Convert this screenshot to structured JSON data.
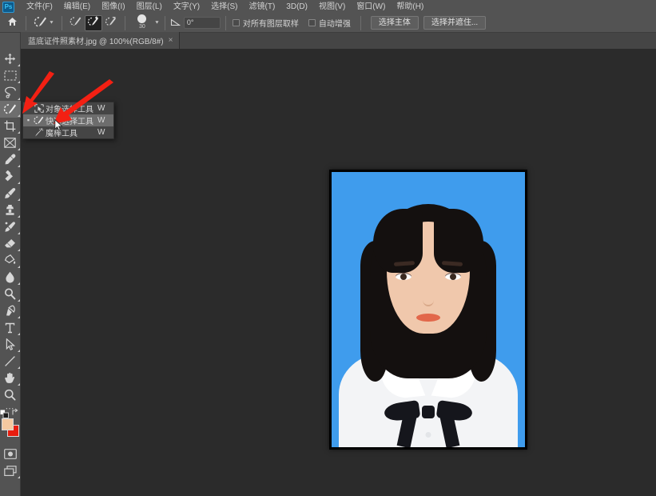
{
  "app": {
    "logo_text": "Ps"
  },
  "menubar": {
    "items": [
      {
        "label": "文件(F)"
      },
      {
        "label": "编辑(E)"
      },
      {
        "label": "图像(I)"
      },
      {
        "label": "图层(L)"
      },
      {
        "label": "文字(Y)"
      },
      {
        "label": "选择(S)"
      },
      {
        "label": "滤镜(T)"
      },
      {
        "label": "3D(D)"
      },
      {
        "label": "视图(V)"
      },
      {
        "label": "窗口(W)"
      },
      {
        "label": "帮助(H)"
      }
    ]
  },
  "optionsbar": {
    "home_icon": "home-icon",
    "tool_preview_icon": "quick-selection-tool-icon",
    "mode_new_icon": "selection-new-icon",
    "mode_add_icon": "selection-add-icon",
    "mode_subtract_icon": "selection-subtract-icon",
    "brush_size": "30",
    "angle_value": "0°",
    "sample_all_layers_label": "对所有图层取样",
    "auto_enhance_label": "自动增强",
    "select_subject_label": "选择主体",
    "select_and_mask_label": "选择并遮住..."
  },
  "tabs": [
    {
      "title": "蓝底证件照素材.jpg @ 100%(RGB/8#)",
      "close": "×"
    }
  ],
  "toolbar": {
    "tools": [
      {
        "name": "move-tool",
        "icon": "move-icon"
      },
      {
        "name": "rectangular-marquee-tool",
        "icon": "marquee-icon"
      },
      {
        "name": "lasso-tool",
        "icon": "lasso-icon"
      },
      {
        "name": "quick-selection-tool",
        "icon": "quick-selection-icon",
        "selected": true
      },
      {
        "name": "crop-tool",
        "icon": "crop-icon"
      },
      {
        "name": "frame-tool",
        "icon": "frame-icon"
      },
      {
        "name": "eyedropper-tool",
        "icon": "eyedropper-icon"
      },
      {
        "name": "spot-healing-brush-tool",
        "icon": "healing-brush-icon"
      },
      {
        "name": "brush-tool",
        "icon": "brush-icon"
      },
      {
        "name": "clone-stamp-tool",
        "icon": "clone-stamp-icon"
      },
      {
        "name": "history-brush-tool",
        "icon": "history-brush-icon"
      },
      {
        "name": "eraser-tool",
        "icon": "eraser-icon"
      },
      {
        "name": "gradient-tool",
        "icon": "paint-bucket-icon"
      },
      {
        "name": "blur-tool",
        "icon": "blur-drop-icon"
      },
      {
        "name": "dodge-tool",
        "icon": "dodge-icon"
      },
      {
        "name": "pen-tool",
        "icon": "pen-icon"
      },
      {
        "name": "type-tool",
        "icon": "type-icon"
      },
      {
        "name": "path-selection-tool",
        "icon": "path-arrow-icon"
      },
      {
        "name": "line-tool",
        "icon": "line-icon"
      },
      {
        "name": "hand-tool",
        "icon": "hand-icon"
      },
      {
        "name": "zoom-tool",
        "icon": "zoom-icon"
      }
    ],
    "more_tools_icon": "ellipsis-icon",
    "swap_colors_icon": "swap-colors-icon",
    "default_colors_icon": "default-colors-icon",
    "foreground_color": "#f5c9a0",
    "background_color": "#e71d0f",
    "quick_mask_icon": "quick-mask-icon",
    "screen_mode_icon": "screen-mode-icon"
  },
  "flyout": {
    "items": [
      {
        "label": "对象选择工具",
        "shortcut": "W",
        "icon": "object-selection-icon",
        "bullet": "",
        "highlighted": false
      },
      {
        "label": "快速选择工具",
        "shortcut": "W",
        "icon": "quick-selection-icon",
        "bullet": "▪",
        "highlighted": true
      },
      {
        "label": "魔棒工具",
        "shortcut": "W",
        "icon": "magic-wand-icon",
        "bullet": "",
        "highlighted": false
      }
    ]
  },
  "canvas": {
    "background_color": "#2b2b2b",
    "photo": {
      "name": "id-photo-blue-background",
      "background_color": "#3f9ced",
      "shirt_color": "#ffffff",
      "hair_color": "#14100f",
      "bowtie_color": "#15161c"
    }
  },
  "annotations": {
    "arrow_color": "#f32013",
    "arrows": [
      {
        "name": "arrow-pointing-to-toolbar"
      },
      {
        "name": "arrow-pointing-to-quick-selection-menu-item"
      }
    ],
    "cursor_icon": "mouse-cursor-icon"
  }
}
